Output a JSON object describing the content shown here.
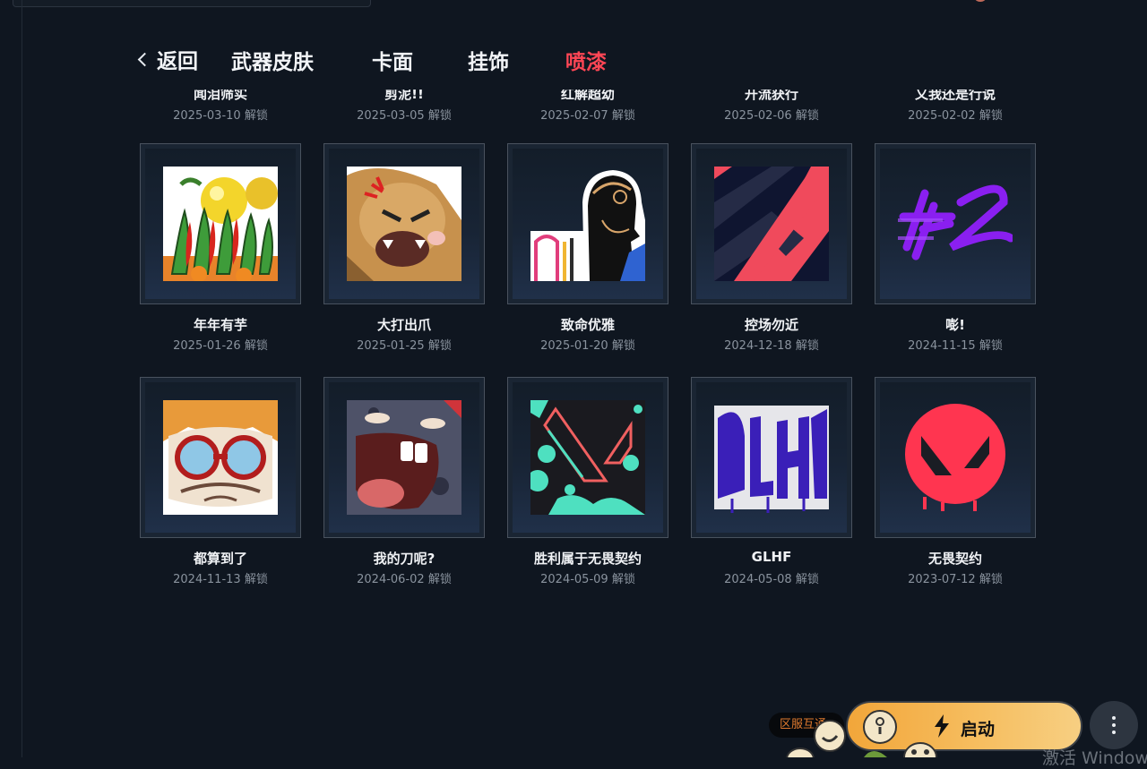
{
  "nav": {
    "back_label": "返回",
    "tabs": [
      {
        "label": "武器皮肤",
        "active": false
      },
      {
        "label": "卡面",
        "active": false
      },
      {
        "label": "挂饰",
        "active": false
      },
      {
        "label": "喷漆",
        "active": true
      }
    ]
  },
  "unlock_suffix": "解锁",
  "sprays_top_row": [
    {
      "name": "闻泪筛实",
      "date": "2025-03-10"
    },
    {
      "name": "剪泥!!",
      "date": "2025-03-05"
    },
    {
      "name": "红解超幼",
      "date": "2025-02-07"
    },
    {
      "name": "开流获行",
      "date": "2025-02-06"
    },
    {
      "name": "又我还是行说",
      "date": "2025-02-02"
    }
  ],
  "sprays": [
    {
      "name": "年年有芋",
      "date": "2025-01-26",
      "art": "vegetable-basket-art"
    },
    {
      "name": "大打出爪",
      "date": "2025-01-25",
      "art": "angry-cat-art"
    },
    {
      "name": "致命优雅",
      "date": "2025-01-20",
      "art": "agent-profile-art"
    },
    {
      "name": "控场勿近",
      "date": "2024-12-18",
      "art": "chevron-logo-art"
    },
    {
      "name": "嘭!",
      "date": "2024-11-15",
      "art": "purple-graffiti-art"
    },
    {
      "name": "都算到了",
      "date": "2024-11-13",
      "art": "goggles-character-art"
    },
    {
      "name": "我的刀呢?",
      "date": "2024-06-02",
      "art": "crying-creature-art"
    },
    {
      "name": "胜利属于无畏契约",
      "date": "2024-05-09",
      "art": "valorant-logo-splatter-art"
    },
    {
      "name": "GLHF",
      "date": "2024-05-08",
      "art": "glhf-graffiti-art"
    },
    {
      "name": "无畏契约",
      "date": "2023-07-12",
      "art": "valorant-red-circle-art"
    }
  ],
  "footer": {
    "region_tag": "区服互通",
    "launch_label": "启动",
    "watermark": "激活 Windows"
  },
  "colors": {
    "background": "#0f1620",
    "active_tab": "#ff4655",
    "launch_button": "#f6bf62"
  }
}
